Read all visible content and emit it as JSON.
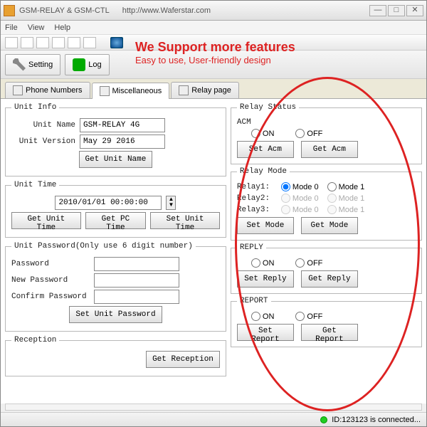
{
  "window": {
    "title": "GSM-RELAY & GSM-CTL",
    "url": "http://www.Waferstar.com"
  },
  "menu": {
    "file": "File",
    "view": "View",
    "help": "Help"
  },
  "toolbar": {
    "setting": "Setting",
    "log": "Log"
  },
  "headline": {
    "h1": "We Support more features",
    "h2": "Easy to use, User-friendly design"
  },
  "tabs": {
    "phone": "Phone Numbers",
    "misc": "Miscellaneous",
    "relay": "Relay page"
  },
  "unitInfo": {
    "legend": "Unit Info",
    "nameLabel": "Unit Name",
    "nameValue": "GSM-RELAY 4G",
    "versionLabel": "Unit Version",
    "versionValue": "May 29 2016",
    "getBtn": "Get Unit Name"
  },
  "unitTime": {
    "legend": "Unit Time",
    "value": "2010/01/01 00:00:00",
    "getBtn": "Get Unit Time",
    "pcBtn": "Get PC Time",
    "setBtn": "Set Unit Time"
  },
  "unitPwd": {
    "legend": "Unit Password(Only use 6 digit number)",
    "pwdLabel": "Password",
    "newLabel": "New Password",
    "confirmLabel": "Confirm Password",
    "setBtn": "Set Unit Password"
  },
  "reception": {
    "legend": "Reception",
    "getBtn": "Get Reception"
  },
  "relayStatus": {
    "legend": "Relay Status",
    "acm": "ACM",
    "on": "ON",
    "off": "OFF",
    "setAcm": "Set Acm",
    "getAcm": "Get Acm"
  },
  "relayMode": {
    "legend": "Relay Mode",
    "r1": "Relay1:",
    "r2": "Relay2:",
    "r3": "Relay3:",
    "m0": "Mode 0",
    "m1": "Mode 1",
    "setBtn": "Set Mode",
    "getBtn": "Get Mode"
  },
  "reply": {
    "legend": "REPLY",
    "on": "ON",
    "off": "OFF",
    "setBtn": "Set Reply",
    "getBtn": "Get Reply"
  },
  "report": {
    "legend": "REPORT",
    "on": "ON",
    "off": "OFF",
    "setBtn": "Set Report",
    "getBtn": "Get Report"
  },
  "status": {
    "text": "ID:123123 is connected..."
  }
}
